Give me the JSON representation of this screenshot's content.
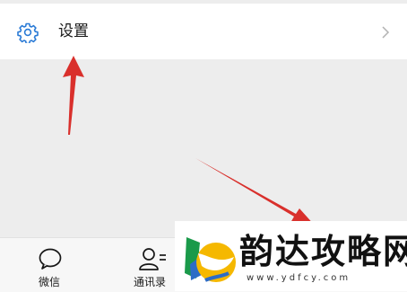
{
  "settings": {
    "label": "设置",
    "icon": "gear-icon",
    "chevron_icon": "chevron-right-icon",
    "icon_color": "#2b7bd6"
  },
  "tabbar": {
    "tabs": [
      {
        "label": "微信",
        "icon": "chat-bubble-icon"
      },
      {
        "label": "通讯录",
        "icon": "contacts-icon"
      }
    ]
  },
  "annotation": {
    "arrow_color": "#d9302c"
  },
  "watermark": {
    "title": "韵达攻略网",
    "url": "www.ydfcy.com"
  }
}
